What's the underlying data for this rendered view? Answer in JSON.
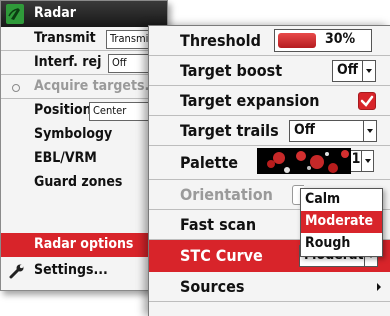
{
  "radar_menu": {
    "title": "Radar",
    "items": [
      {
        "label": "Transmit",
        "control": "Transmit"
      },
      {
        "label": "Interf. rej",
        "control": "Off"
      },
      {
        "label": "Acquire targets..."
      },
      {
        "label": "Position",
        "control": "Center"
      },
      {
        "label": "Symbology"
      },
      {
        "label": "EBL/VRM"
      },
      {
        "label": "Guard zones"
      },
      {
        "label": "Radar options"
      },
      {
        "label": "Settings..."
      }
    ]
  },
  "options_menu": {
    "threshold": {
      "label": "Threshold",
      "value": "30%",
      "level": 0.3
    },
    "target_boost": {
      "label": "Target boost",
      "value": "Off"
    },
    "target_expansion": {
      "label": "Target expansion",
      "checked": true
    },
    "target_trails": {
      "label": "Target trails",
      "value": "Off"
    },
    "palette": {
      "label": "Palette",
      "value": "1"
    },
    "orientation": {
      "label": "Orientation"
    },
    "fast_scan": {
      "label": "Fast scan"
    },
    "stc_curve": {
      "label": "STC Curve",
      "value": "Moderate"
    },
    "sources": {
      "label": "Sources"
    }
  },
  "stc_popup": {
    "options": [
      "Calm",
      "Moderate",
      "Rough"
    ],
    "selected": "Moderate"
  },
  "colors": {
    "accent": "#d8242a",
    "header": "#202020",
    "logo": "#2f9a3a"
  },
  "icons": {
    "logo": "radar-logo-icon",
    "settings": "wrench-icon",
    "radio": "radio-indicator-icon",
    "submenu": "chevron-right-icon",
    "dropdown": "chevron-down-icon",
    "check": "check-icon"
  }
}
